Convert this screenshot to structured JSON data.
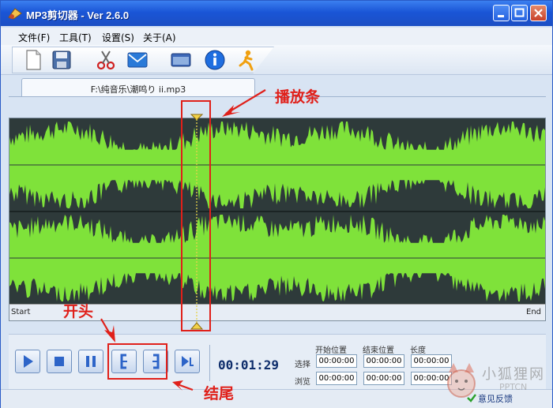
{
  "window": {
    "title": "MP3剪切器 - Ver 2.6.0"
  },
  "menu": {
    "items": [
      "文件(F)",
      "工具(T)",
      "设置(S)",
      "关于(A)"
    ]
  },
  "toolbar": {
    "icons": [
      "new-file-icon",
      "save-icon",
      "scissors-icon",
      "email-icon",
      "window-icon",
      "info-icon",
      "runner-icon"
    ]
  },
  "tab": {
    "label": "F:\\纯音乐\\潮鸣り ii.mp3"
  },
  "waveform": {
    "start_label": "Start",
    "end_label": "End",
    "playhead_fraction": 0.346,
    "colors": {
      "wave": "#7fe23a",
      "background": "#2e3a3a"
    }
  },
  "controls": {
    "time": "00:01:29",
    "headers": [
      "开始位置",
      "结束位置",
      "长度"
    ],
    "rows": [
      {
        "label": "选择",
        "values": [
          "00:00:00",
          "00:00:00",
          "00:00:00"
        ]
      },
      {
        "label": "浏览",
        "values": [
          "00:00:00",
          "00:00:00",
          "00:00:00"
        ]
      }
    ]
  },
  "status": {
    "feedback": "意见反馈"
  },
  "annotations": {
    "playbar": "播放条",
    "start": "开头",
    "end": "结尾",
    "color": "#e0201a"
  },
  "watermark": {
    "text": "小狐狸网",
    "url": "PPTCN"
  }
}
